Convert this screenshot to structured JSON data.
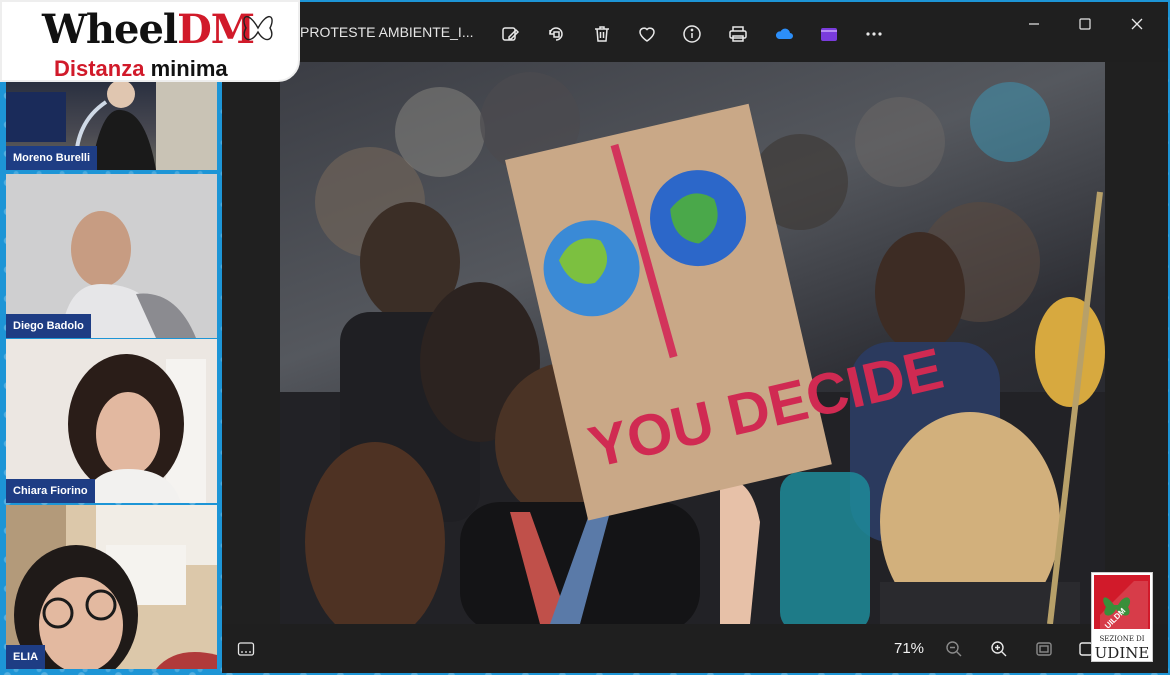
{
  "logo": {
    "brand_black": "Wheel",
    "brand_red": "DM",
    "tagline_red": "Distanza ",
    "tagline_dark": "minima"
  },
  "participants": [
    {
      "name": "Moreno Burelli"
    },
    {
      "name": "Diego Badolo"
    },
    {
      "name": "Chiara Fiorino"
    },
    {
      "name": "ELIA"
    }
  ],
  "viewer": {
    "file_title": "PROTESTE AMBIENTE_I...",
    "toolbar": [
      "edit-image-icon",
      "rotate-icon",
      "delete-icon",
      "favorite-icon",
      "info-icon",
      "print-icon",
      "onedrive-icon",
      "clipchamp-icon",
      "more-icon"
    ],
    "zoom": "71%"
  },
  "photo": {
    "sign_text": "YOU DECIDE"
  },
  "badge": {
    "org": "UILDM",
    "line1": "SEZIONE DI",
    "line2": "UDINE"
  },
  "colors": {
    "background": "#1d95d6",
    "name_tag": "#1e3d84",
    "brand_red": "#d11a2a"
  }
}
